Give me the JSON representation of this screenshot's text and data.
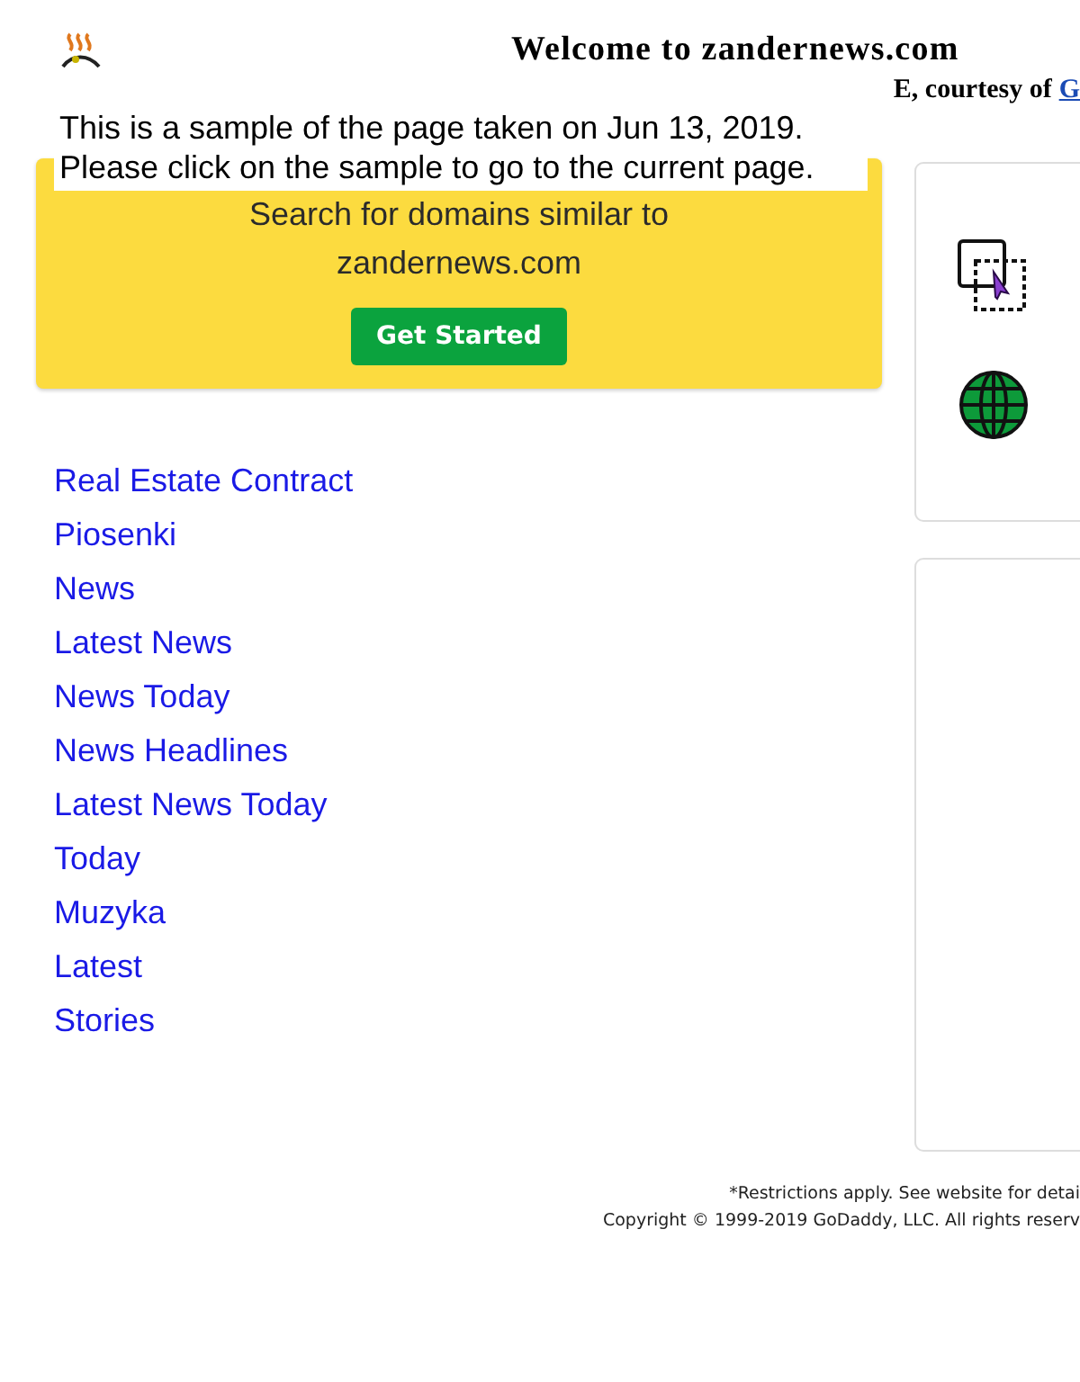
{
  "header": {
    "title": "Welcome to zandernews.com",
    "courtesy": "E, courtesy of",
    "courtesy_link": "G"
  },
  "notice": [
    "This is a sample of the page taken on Jun 13, 2019.",
    "Please click on the sample to go to the current page."
  ],
  "domain_card": {
    "heading": "Search for domains similar to",
    "domain": "zandernews.com",
    "button": "Get Started"
  },
  "links": [
    "Real Estate Contract",
    "Piosenki",
    "News",
    "Latest News",
    "News Today",
    "News Headlines",
    "Latest News Today",
    "Today",
    "Muzyka",
    "Latest",
    "Stories"
  ],
  "footer": [
    "*Restrictions apply. See website for detai",
    "Copyright © 1999-2019 GoDaddy, LLC. All rights reserv"
  ]
}
